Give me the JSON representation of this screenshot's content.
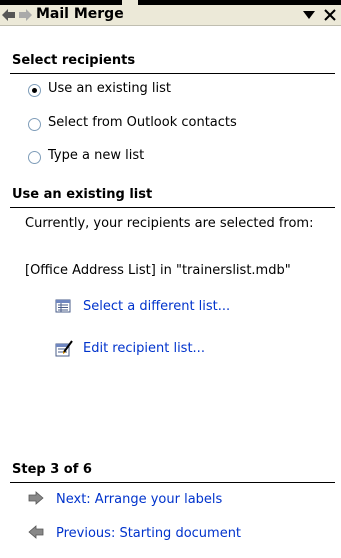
{
  "title": "Mail Merge",
  "select_recipients": {
    "heading": "Select recipients",
    "options": [
      {
        "label": "Use an existing list",
        "selected": true
      },
      {
        "label": "Select from Outlook contacts",
        "selected": false
      },
      {
        "label": "Type a new list",
        "selected": false
      }
    ]
  },
  "existing_list": {
    "heading": "Use an existing list",
    "description": "Currently, your recipients are selected from:",
    "source": "[Office Address List] in \"trainerslist.mdb\"",
    "select_link": "Select a different list...",
    "edit_link": "Edit recipient list..."
  },
  "step": {
    "heading": "Step 3 of 6",
    "next_link": "Next: Arrange your labels",
    "previous_link": "Previous: Starting document"
  },
  "colors": {
    "link": "#0033cc",
    "pane_bg": "#ffffff",
    "title_bg": "#ece9d8"
  }
}
